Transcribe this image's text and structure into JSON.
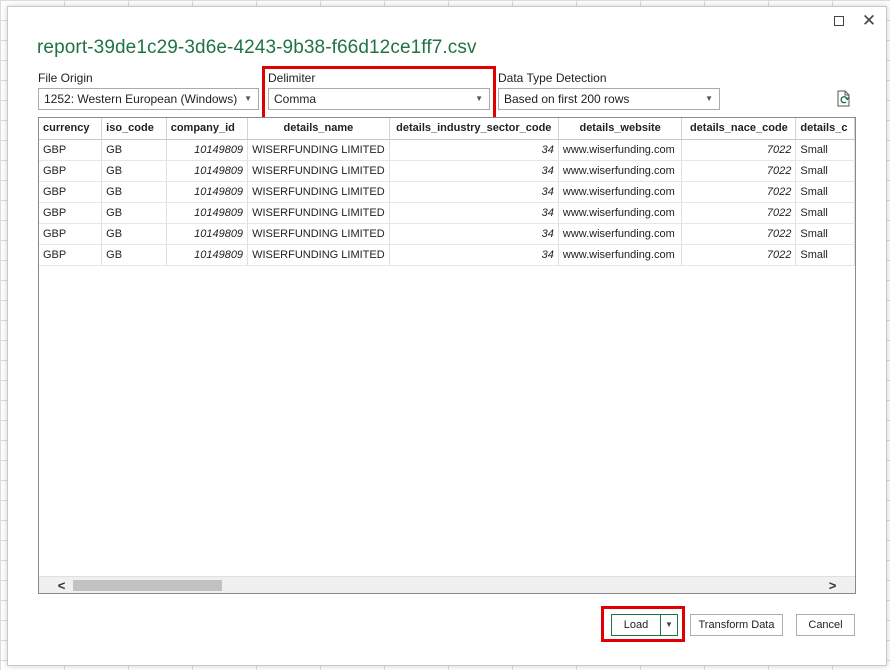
{
  "dialog": {
    "title": "report-39de1c29-3d6e-4243-9b38-f66d12ce1ff7.csv"
  },
  "file_origin": {
    "label": "File Origin",
    "value": "1252: Western European (Windows)"
  },
  "delimiter": {
    "label": "Delimiter",
    "value": "Comma"
  },
  "data_type_detection": {
    "label": "Data Type Detection",
    "value": "Based on first 200 rows"
  },
  "table": {
    "columns": [
      "currency",
      "iso_code",
      "company_id",
      "details_name",
      "details_industry_sector_code",
      "details_website",
      "details_nace_code",
      "details_c"
    ],
    "rows": [
      [
        "GBP",
        "GB",
        "10149809",
        "WISERFUNDING LIMITED",
        "34",
        "www.wiserfunding.com",
        "7022",
        "Small"
      ],
      [
        "GBP",
        "GB",
        "10149809",
        "WISERFUNDING LIMITED",
        "34",
        "www.wiserfunding.com",
        "7022",
        "Small"
      ],
      [
        "GBP",
        "GB",
        "10149809",
        "WISERFUNDING LIMITED",
        "34",
        "www.wiserfunding.com",
        "7022",
        "Small"
      ],
      [
        "GBP",
        "GB",
        "10149809",
        "WISERFUNDING LIMITED",
        "34",
        "www.wiserfunding.com",
        "7022",
        "Small"
      ],
      [
        "GBP",
        "GB",
        "10149809",
        "WISERFUNDING LIMITED",
        "34",
        "www.wiserfunding.com",
        "7022",
        "Small"
      ],
      [
        "GBP",
        "GB",
        "10149809",
        "WISERFUNDING LIMITED",
        "34",
        "www.wiserfunding.com",
        "7022",
        "Small"
      ]
    ]
  },
  "buttons": {
    "load": "Load",
    "transform": "Transform Data",
    "cancel": "Cancel"
  },
  "icons": {
    "maximize": "maximize-icon",
    "close": "close-icon",
    "refresh": "refresh-preview-icon",
    "dropdown": "chevron-down-icon"
  },
  "colors": {
    "title": "#217346",
    "highlight": "#e00000"
  }
}
